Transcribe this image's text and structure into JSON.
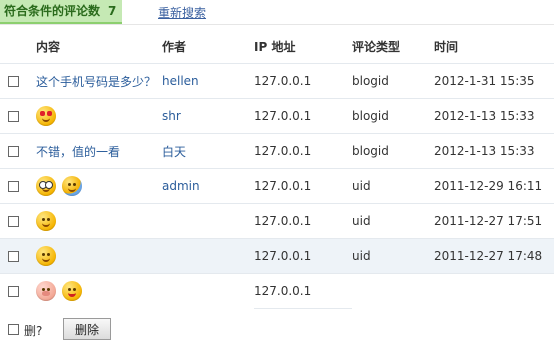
{
  "summary": {
    "label": "符合条件的评论数",
    "count": "7",
    "research_link": "重新搜索"
  },
  "table": {
    "headers": {
      "content": "内容",
      "author": "作者",
      "ip": "IP 地址",
      "type": "评论类型",
      "time": "时间"
    },
    "rows": [
      {
        "content": "这个手机号码是多少？",
        "emoticons": [],
        "author": "hellen",
        "ip": "127.0.0.1",
        "type": "blogid",
        "time": "2012-1-31 15:35"
      },
      {
        "content": "",
        "emoticons": [
          "heart-eyes-emoticon"
        ],
        "author": "shr",
        "ip": "127.0.0.1",
        "type": "blogid",
        "time": "2012-1-13 15:33"
      },
      {
        "content": "不错，值的一看",
        "emoticons": [],
        "author": "白天",
        "ip": "127.0.0.1",
        "type": "blogid",
        "time": "2012-1-13 15:33"
      },
      {
        "content": "",
        "emoticons": [
          "glasses-emoticon",
          "sweat-emoticon"
        ],
        "author": "admin",
        "ip": "127.0.0.1",
        "type": "uid",
        "time": "2011-12-29 16:11"
      },
      {
        "content": "",
        "emoticons": [
          "smile-emoticon"
        ],
        "author": "",
        "ip": "127.0.0.1",
        "type": "uid",
        "time": "2011-12-27 17:51"
      },
      {
        "content": "",
        "emoticons": [
          "smile-emoticon"
        ],
        "author": "",
        "ip": "127.0.0.1",
        "type": "uid",
        "time": "2011-12-27 17:48"
      },
      {
        "content": "",
        "emoticons": [
          "pig-emoticon",
          "tongue-emoticon"
        ],
        "author": "",
        "ip": "127.0.0.1",
        "type": "",
        "time": ""
      }
    ]
  },
  "footer": {
    "delete_label": "删?",
    "delete_button": "删除"
  },
  "colors": {
    "summary_bg": "#c5e9b4",
    "summary_text": "#2a6b1c",
    "link": "#2b5d9b",
    "row_highlight": "#eef3f8"
  }
}
